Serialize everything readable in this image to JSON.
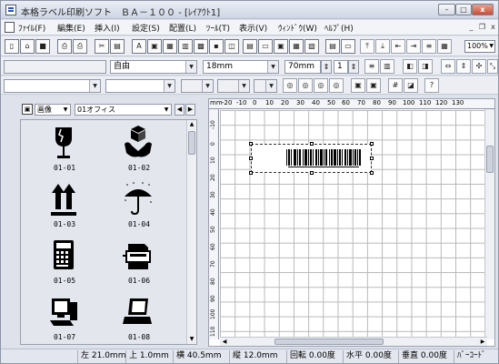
{
  "window": {
    "title": "本格ラベル印刷ソフト　ＢＡ－１００ - [ﾚｲｱｳﾄ1]",
    "minimize": "–",
    "maximize": "□",
    "close": "x"
  },
  "menu": {
    "items": [
      "ﾌｧｲﾙ(F)",
      "編集(E)",
      "挿入(I)",
      "設定(S)",
      "配置(L)",
      "ﾂｰﾙ(T)",
      "表示(V)",
      "ｳｨﾝﾄﾞｳ(W)",
      "ﾍﾙﾌﾟ(H)"
    ],
    "mdi_min": "_",
    "mdi_restore": "❐",
    "mdi_close": "x"
  },
  "toolbar": {
    "zoom": "100%"
  },
  "format_bar": {
    "font_name": "",
    "style": "自由",
    "font_size": "18mm",
    "width": "70mm",
    "count": "1"
  },
  "clipart_panel": {
    "category_icon": "picture-icon",
    "category": "画像",
    "subcategory": "01オフィス",
    "prev": "◀",
    "next": "▶",
    "items": [
      {
        "code": "01-01",
        "icon": "fragile-glass-icon"
      },
      {
        "code": "01-02",
        "icon": "handle-with-care-icon"
      },
      {
        "code": "01-03",
        "icon": "this-side-up-icon"
      },
      {
        "code": "01-04",
        "icon": "keep-dry-umbrella-icon"
      },
      {
        "code": "01-05",
        "icon": "calculator-icon"
      },
      {
        "code": "01-06",
        "icon": "copier-icon"
      },
      {
        "code": "01-07",
        "icon": "desktop-pc-icon"
      },
      {
        "code": "01-08",
        "icon": "laptop-icon"
      }
    ]
  },
  "ruler": {
    "unit": "mm",
    "top_ticks": [
      "-20",
      "-10",
      "0",
      "10",
      "20",
      "30",
      "40",
      "50",
      "60",
      "70",
      "80",
      "90",
      "100",
      "110",
      "120",
      "130"
    ],
    "left_ticks": [
      "-10",
      "0",
      "10",
      "20",
      "30",
      "40",
      "50",
      "60",
      "70",
      "80",
      "90",
      "100",
      "110"
    ]
  },
  "statusbar": {
    "left_label": "左",
    "left_value": "21.0mm",
    "top_label": "上",
    "top_value": "1.0mm",
    "width_label": "横",
    "width_value": "40.5mm",
    "height_label": "縦",
    "height_value": "12.0mm",
    "rotate_label": "回転",
    "rotate_value": "0.00度",
    "horiz_label": "水平",
    "horiz_value": "0.00度",
    "vert_label": "垂直",
    "vert_value": "0.00度",
    "type": "ﾊﾞｰｺｰﾄﾞ"
  }
}
